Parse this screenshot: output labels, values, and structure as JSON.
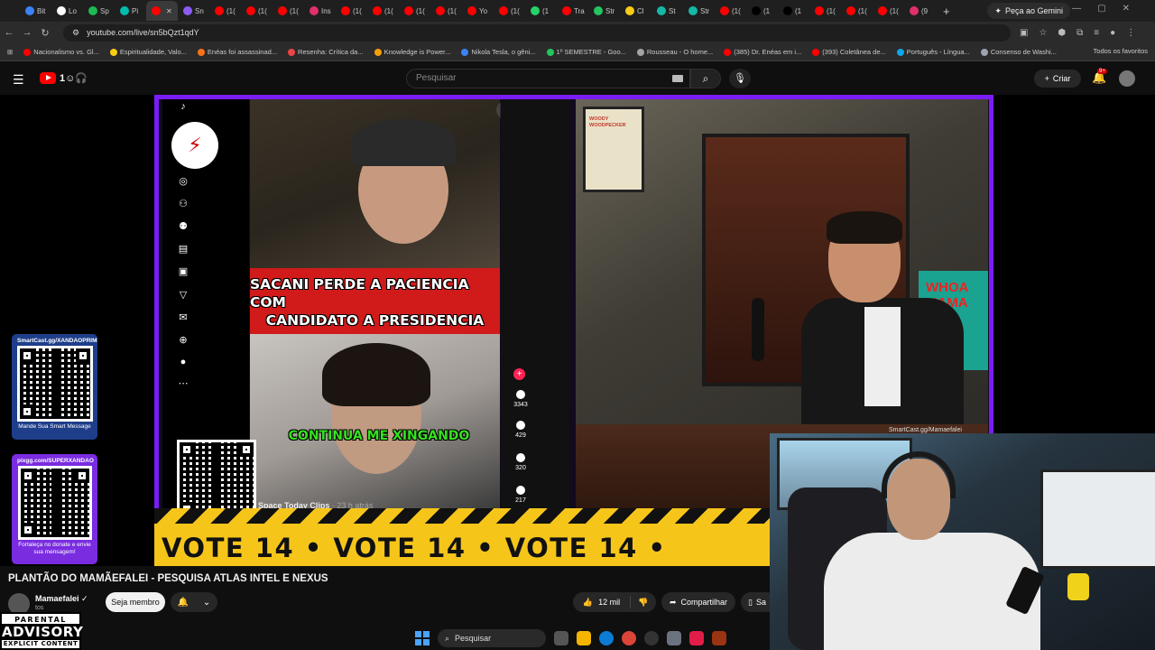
{
  "browser": {
    "tabs": [
      {
        "label": "Bit",
        "color": "#3b82f6"
      },
      {
        "label": "Lo",
        "color": "#ffffff"
      },
      {
        "label": "Sp",
        "color": "#1db954"
      },
      {
        "label": "Pi",
        "color": "#00bdae"
      },
      {
        "label": "",
        "color": "#ff0000",
        "active": true
      },
      {
        "label": "Sn",
        "color": "#8b5cf6"
      },
      {
        "label": "(1(",
        "color": "#ff0000"
      },
      {
        "label": "(1(",
        "color": "#ff0000"
      },
      {
        "label": "(1(",
        "color": "#ff0000"
      },
      {
        "label": "Ins",
        "color": "#e1306c"
      },
      {
        "label": "(1(",
        "color": "#ff0000"
      },
      {
        "label": "(1(",
        "color": "#ff0000"
      },
      {
        "label": "(1(",
        "color": "#ff0000"
      },
      {
        "label": "(1(",
        "color": "#ff0000"
      },
      {
        "label": "Yo",
        "color": "#ff0000"
      },
      {
        "label": "(1(",
        "color": "#ff0000"
      },
      {
        "label": "(1",
        "color": "#25d366"
      },
      {
        "label": "Tra",
        "color": "#ff0000"
      },
      {
        "label": "Str",
        "color": "#22c55e"
      },
      {
        "label": "Cl",
        "color": "#facc15"
      },
      {
        "label": "St",
        "color": "#14b8a6"
      },
      {
        "label": "Str",
        "color": "#14b8a6"
      },
      {
        "label": "(1(",
        "color": "#ff0000"
      },
      {
        "label": "(1",
        "color": "#000000"
      },
      {
        "label": "(1",
        "color": "#000000"
      },
      {
        "label": "(1(",
        "color": "#ff0000"
      },
      {
        "label": "(1(",
        "color": "#ff0000"
      },
      {
        "label": "(1(",
        "color": "#ff0000"
      },
      {
        "label": "(9",
        "color": "#e1306c"
      }
    ],
    "gemini_label": "Peça ao Gemini",
    "url": "youtube.com/live/sn5bQzt1qdY",
    "bookmarks": [
      {
        "label": "Nacionalismo vs. Gl...",
        "color": "#ff0000"
      },
      {
        "label": "Espiritualidade, Valo...",
        "color": "#facc15"
      },
      {
        "label": "Enéas foi assassinad...",
        "color": "#f97316"
      },
      {
        "label": "Resenha: Crítica da...",
        "color": "#ef4444"
      },
      {
        "label": "Knowledge is Power...",
        "color": "#f59e0b"
      },
      {
        "label": "Nikola Tesla, o gêni...",
        "color": "#3b82f6"
      },
      {
        "label": "1º SEMESTRE - Goo...",
        "color": "#22c55e"
      },
      {
        "label": "Rousseau - O home...",
        "color": "#a3a3a3"
      },
      {
        "label": "(385) Dr. Enéas em i...",
        "color": "#ff0000"
      },
      {
        "label": "(393) Coletânea de...",
        "color": "#ff0000"
      },
      {
        "label": "Português - Língua...",
        "color": "#0ea5e9"
      },
      {
        "label": "Consenso de Washi...",
        "color": "#9ca3af"
      }
    ],
    "all_bookmarks": "Todos os favoritos"
  },
  "youtube": {
    "search_placeholder": "Pesquisar",
    "create_label": "Criar",
    "notification_count": "9+"
  },
  "stream": {
    "clip_headline_1": "SACANI PERDE A PACIENCIA COM",
    "clip_headline_2": "CANDIDATO A PRESIDENCIA",
    "clip_subtitle": "CONTINUA ME XINGANDO",
    "clip_source": "Space Today Clips",
    "clip_age": "· 23 h atrás",
    "tiktok_counts": [
      "3343",
      "429",
      "320",
      "217"
    ],
    "vote_text": "VOTE 14  •  VOTE 14  •  VOTE 14  •",
    "poster_title": "WOODY WOODPECKER",
    "wall_sign": "WHOA MAMA",
    "cam_watermark": "SmartCast.gg/Mamaefalei",
    "smartcast_1": {
      "url": "SmartCast.gg/XANDAOPRIME",
      "caption": "Mande Sua Smart Message"
    },
    "smartcast_2": {
      "url": "pixgg.com/SUPERXANDAO",
      "caption": "Fortaleça no donate e envie sua mensagem!"
    }
  },
  "video": {
    "title": "PLANTÃO DO MAMÃEFALEI - PESQUISA ATLAS INTEL E NEXUS",
    "channel": "Mamaefalei",
    "subs_fragment": "tos",
    "member_button": "Seja membro",
    "likes": "12 mil",
    "share": "Compartilhar",
    "save": "Sa"
  },
  "advisory": {
    "line1": "PARENTAL",
    "line2": "ADVISORY",
    "line3": "EXPLICIT CONTENT"
  },
  "taskbar": {
    "search_label": "Pesquisar"
  }
}
